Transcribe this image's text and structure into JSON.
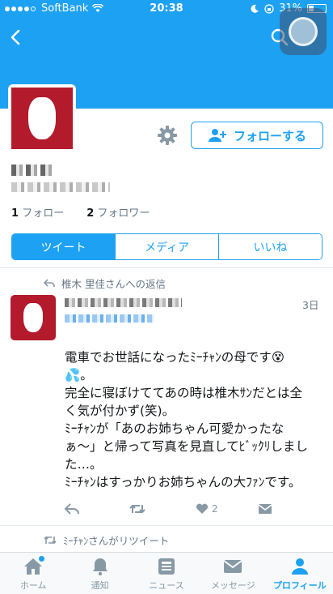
{
  "status_bar": {
    "carrier": "SoftBank",
    "time": "20:38",
    "battery": "31%",
    "battery_level": 0.31
  },
  "profile": {
    "follow_button_label": "フォローする",
    "following_count": "1",
    "following_label": "フォロー",
    "followers_count": "2",
    "followers_label": "フォロワー"
  },
  "tabs": [
    {
      "label": "ツイート",
      "active": true
    },
    {
      "label": "メディア",
      "active": false
    },
    {
      "label": "いいね",
      "active": false
    }
  ],
  "tweet": {
    "reply_to": "椎木 里佳さんへの返信",
    "time": "3日",
    "lines": [
      "電車でお世話になったﾐｰﾁｬﾝの母です😵",
      "💦。",
      "完全に寝ぼけててあの時は椎木ｻﾝだとは全く気が付かず(笑)。",
      "ﾐｰﾁｬﾝが「あのお姉ちゃん可愛かったなぁ〜」と帰って写真を見直してﾋﾞｯｸﾘしました…。",
      "ﾐｰﾁｬﾝはすっかりお姉ちゃんの大ﾌｧﾝです。"
    ],
    "like_count": "2"
  },
  "retweet_line": "ﾐｰﾁｬﾝさんがリツイート",
  "bottom_nav": [
    {
      "label": "ホーム",
      "icon": "home-icon",
      "active": false
    },
    {
      "label": "通知",
      "icon": "bell-icon",
      "active": false
    },
    {
      "label": "ニュース",
      "icon": "news-icon",
      "active": false
    },
    {
      "label": "メッセージ",
      "icon": "envelope-icon",
      "active": false
    },
    {
      "label": "プロフィール",
      "icon": "person-icon",
      "active": true
    }
  ],
  "colors": {
    "accent": "#1da1f2",
    "avatar_red": "#b31b2c",
    "muted": "#657786"
  }
}
